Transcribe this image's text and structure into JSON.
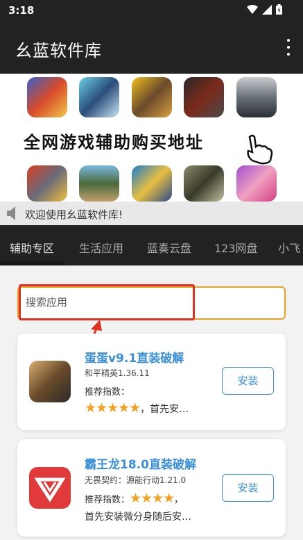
{
  "status_bar": {
    "time": "3:18"
  },
  "app_bar": {
    "title": "幺蓝软件库"
  },
  "banner": {
    "text": "全网游戏辅助购买地址"
  },
  "notice": {
    "text": "欢迎使用幺蓝软件库!"
  },
  "tabs": [
    {
      "label": "辅助专区"
    },
    {
      "label": "生活应用"
    },
    {
      "label": "蓝奏云盘"
    },
    {
      "label": "123网盘"
    },
    {
      "label": "小飞"
    }
  ],
  "search": {
    "placeholder": "搜索应用"
  },
  "apps": [
    {
      "title": "蛋蛋v9.1直装破解",
      "subtitle": "和平精英1.36.11",
      "rec_label": "推荐指数：",
      "stars": "★★★★★",
      "rec_suffix": "，首先安…",
      "desc": "",
      "button": "安装"
    },
    {
      "title": "霸王龙18.0直装破解",
      "subtitle": "无畏契约：源能行动1.21.0",
      "rec_label": "推荐指数：",
      "stars": "★★★★",
      "rec_suffix": "，",
      "desc": "首先安装微分身随后安…",
      "button": "安装"
    }
  ],
  "colors": {
    "accent": "#3a8fd8",
    "star": "#f2a11f",
    "search_border": "#e8a020",
    "highlight": "#e03020"
  }
}
